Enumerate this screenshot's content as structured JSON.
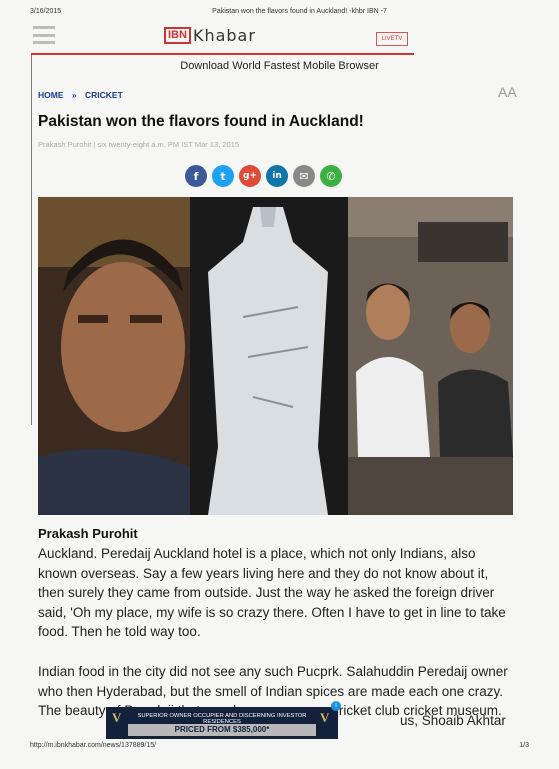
{
  "print_header": {
    "date": "3/16/2015",
    "title": "Pakistan won the flavors found in Auckland! -khbr IBN -7"
  },
  "site": {
    "logo_ibn": "IBN",
    "logo_khabar": "Khabar",
    "live_tv": "LIVETV",
    "download_bar": "Download World Fastest Mobile Browser",
    "text_size_toggle": "AA"
  },
  "breadcrumb": [
    "HOME",
    "»",
    "CRICKET"
  ],
  "article": {
    "title": "Pakistan won the flavors found in Auckland!",
    "byline": "Prakash Purohit | six twenty-eight a.m. PM IST Mar 13, 2015",
    "author": "Prakash Purohit",
    "paragraphs": [
      "Auckland. Peredaij Auckland hotel is a place, which not only Indians, also known overseas. Say a few years living here and they do not know about it, then surely they came from outside. Just the way he asked the foreign driver said, 'Oh my place, my wife is so crazy there. Often I have to get in line to take food. Then he told way too.",
      "Indian food in the city did not see any such Pucprk. Salahuddin Peredaij owner who then Hyderabad, but the smell of Indian spices are made each one crazy. The beauty of Peredaij that may have come as a cricket club cricket museum."
    ],
    "trailing_text": "us, Shoaib Akhtar"
  },
  "share_icons": [
    {
      "name": "facebook-icon",
      "glyph": "f"
    },
    {
      "name": "twitter-icon",
      "glyph": "t"
    },
    {
      "name": "google-plus-icon",
      "glyph": "g+"
    },
    {
      "name": "linkedin-icon",
      "glyph": "in"
    },
    {
      "name": "email-icon",
      "glyph": "✉"
    },
    {
      "name": "whatsapp-icon",
      "glyph": "✆"
    }
  ],
  "ad": {
    "logo": "V",
    "line1": "SUPERIOR OWNER OCCUPIER AND DISCERNING INVESTOR RESIDENCES",
    "line2": "PRICED FROM $385,000*",
    "adchoices": "i"
  },
  "print_footer": {
    "url": "http://m.ibnkhabar.com/news/137889/15/",
    "page": "1/3"
  },
  "colors": {
    "brand_red": "#c33333",
    "breadcrumb_blue": "#1a3d8f"
  }
}
